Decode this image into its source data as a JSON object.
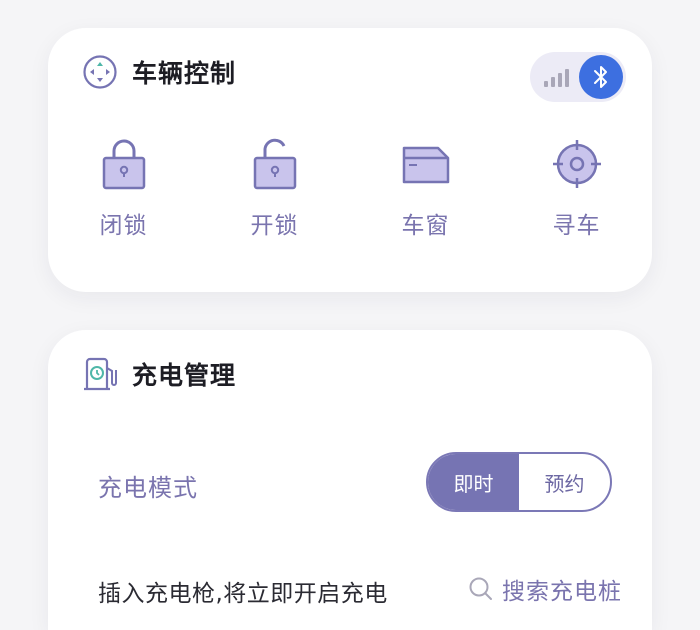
{
  "vehicle_control": {
    "title": "车辆控制",
    "controls": [
      {
        "label": "闭锁",
        "icon": "lock-closed-icon"
      },
      {
        "label": "开锁",
        "icon": "lock-open-icon"
      },
      {
        "label": "车窗",
        "icon": "car-window-icon"
      },
      {
        "label": "寻车",
        "icon": "locate-car-icon"
      }
    ],
    "connection": {
      "signal_icon": "signal-bars-icon",
      "bluetooth_icon": "bluetooth-icon",
      "bluetooth_active": true
    }
  },
  "charge_management": {
    "title": "充电管理",
    "mode_label": "充电模式",
    "modes": [
      {
        "label": "即时",
        "selected": true
      },
      {
        "label": "预约",
        "selected": false
      }
    ],
    "hint": "插入充电枪,将立即开启充电",
    "search_label": "搜索充电桩"
  },
  "colors": {
    "accent": "#7674b3",
    "label": "#7a74ae",
    "icon_fill": "#c9c4ec",
    "bluetooth": "#3d6fe0"
  }
}
